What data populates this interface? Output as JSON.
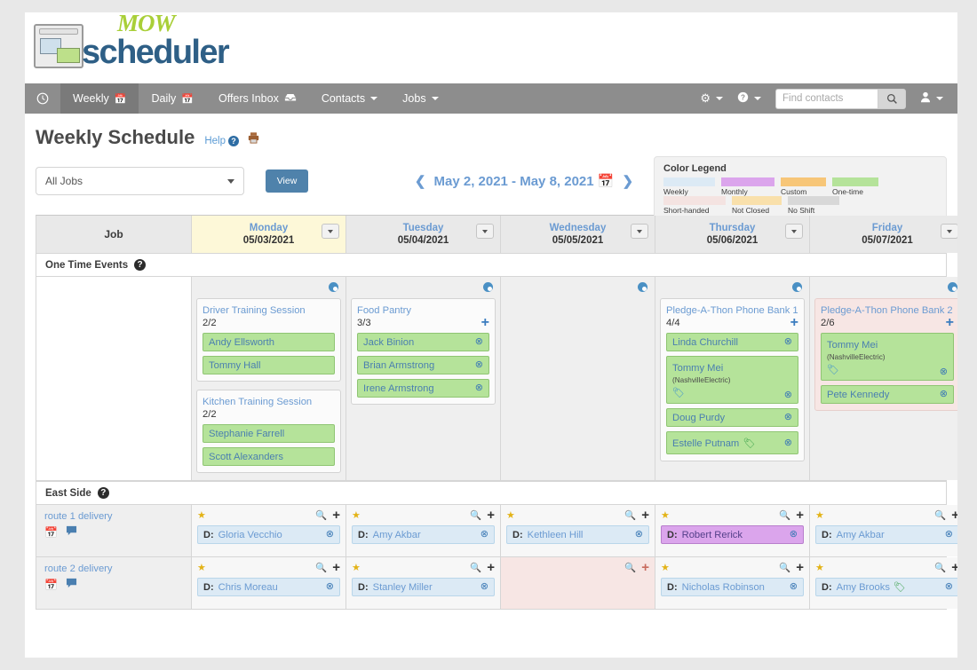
{
  "brand": {
    "mow": "MOW",
    "scheduler": "scheduler"
  },
  "nav": {
    "home_icon": "clock-icon",
    "items": [
      {
        "label": "Weekly",
        "icon": "calendar-icon",
        "active": true
      },
      {
        "label": "Daily",
        "icon": "calendar-icon",
        "active": false
      },
      {
        "label": "Offers Inbox",
        "icon": "inbox-icon",
        "active": false
      },
      {
        "label": "Contacts",
        "icon": "caret-down-icon",
        "active": false
      },
      {
        "label": "Jobs",
        "icon": "caret-down-icon",
        "active": false
      }
    ],
    "right": {
      "gear_icon": "gear-icon",
      "help_icon": "question-circle-icon",
      "user_icon": "user-icon",
      "search_placeholder": "Find contacts",
      "search_value": "",
      "search_button_icon": "search-icon"
    }
  },
  "page": {
    "title": "Weekly Schedule",
    "help_label": "Help",
    "print_icon": "printer-icon"
  },
  "toolbar": {
    "job_filter_value": "All Jobs",
    "view_button": "View",
    "date_range": "May 2, 2021 - May 8, 2021",
    "prev_icon": "chevron-left-icon",
    "next_icon": "chevron-right-icon",
    "calendar_icon": "calendar-icon"
  },
  "legend": {
    "title": "Color Legend",
    "items": [
      {
        "label": "Weekly",
        "color": "#dceaf5"
      },
      {
        "label": "Monthly",
        "color": "#dba5ec"
      },
      {
        "label": "Custom",
        "color": "#f7c678"
      },
      {
        "label": "One-time",
        "color": "#b5e39a"
      },
      {
        "label": "Short-handed",
        "color": "#f4e3e1"
      },
      {
        "label": "Not Closed",
        "color": "#f9e0ab"
      },
      {
        "label": "No Shift",
        "color": "#d8d8d8"
      }
    ]
  },
  "grid": {
    "job_column_header": "Job",
    "days": [
      {
        "name": "Monday",
        "date": "05/03/2021",
        "highlight": true
      },
      {
        "name": "Tuesday",
        "date": "05/04/2021",
        "highlight": false
      },
      {
        "name": "Wednesday",
        "date": "05/05/2021",
        "highlight": false
      },
      {
        "name": "Thursday",
        "date": "05/06/2021",
        "highlight": false
      },
      {
        "name": "Friday",
        "date": "05/07/2021",
        "highlight": false
      }
    ],
    "sections": [
      {
        "title": "One Time Events",
        "help_icon": "question-circle-icon"
      },
      {
        "title": "East Side",
        "help_icon": "question-circle-icon"
      }
    ],
    "one_time_events": [
      {
        "day": "Monday",
        "cards": [
          {
            "title": "Driver Training Session",
            "count": "2/2",
            "short_handed": false,
            "show_plus": false,
            "people": [
              {
                "name": "Andy Ellsworth",
                "sub": "",
                "tag": false,
                "remove": false
              },
              {
                "name": "Tommy Hall",
                "sub": "",
                "tag": false,
                "remove": false
              }
            ]
          },
          {
            "title": "Kitchen Training Session",
            "count": "2/2",
            "short_handed": false,
            "show_plus": false,
            "people": [
              {
                "name": "Stephanie Farrell",
                "sub": "",
                "tag": false,
                "remove": false
              },
              {
                "name": "Scott Alexanders",
                "sub": "",
                "tag": false,
                "remove": false
              }
            ]
          }
        ]
      },
      {
        "day": "Tuesday",
        "cards": [
          {
            "title": "Food Pantry",
            "count": "3/3",
            "short_handed": false,
            "show_plus": true,
            "people": [
              {
                "name": "Jack Binion",
                "sub": "",
                "tag": false,
                "remove": true
              },
              {
                "name": "Brian Armstrong",
                "sub": "",
                "tag": false,
                "remove": true
              },
              {
                "name": "Irene Armstrong",
                "sub": "",
                "tag": false,
                "remove": true
              }
            ]
          }
        ]
      },
      {
        "day": "Wednesday",
        "cards": []
      },
      {
        "day": "Thursday",
        "cards": [
          {
            "title": "Pledge-A-Thon Phone Bank 1",
            "count": "4/4",
            "short_handed": false,
            "show_plus": true,
            "people": [
              {
                "name": "Linda Churchill",
                "sub": "",
                "tag": false,
                "remove": true
              },
              {
                "name": "Tommy Mei",
                "sub": "(NashvilleElectric)",
                "tag": true,
                "remove": true
              },
              {
                "name": "Doug Purdy",
                "sub": "",
                "tag": false,
                "remove": true
              },
              {
                "name": "Estelle Putnam",
                "sub": "",
                "tag": "inline",
                "remove": true
              }
            ]
          }
        ]
      },
      {
        "day": "Friday",
        "cards": [
          {
            "title": "Pledge-A-Thon Phone Bank 2",
            "count": "2/6",
            "short_handed": true,
            "show_plus": true,
            "people": [
              {
                "name": "Tommy Mei",
                "sub": "(NashvilleElectric)",
                "tag": true,
                "remove": true
              },
              {
                "name": "Pete Kennedy",
                "sub": "",
                "tag": false,
                "remove": true
              }
            ]
          }
        ]
      }
    ],
    "job_rows": [
      {
        "name": "route 1 delivery",
        "icons": [
          "calendar-icon",
          "comment-icon"
        ],
        "cells": [
          {
            "day": "Monday",
            "short_handed": false,
            "star": true,
            "plus_red": false,
            "slots": [
              {
                "label": "D:",
                "name": "Gloria Vecchio",
                "type": "weekly",
                "tag": false,
                "remove": true
              }
            ]
          },
          {
            "day": "Tuesday",
            "short_handed": false,
            "star": true,
            "plus_red": false,
            "slots": [
              {
                "label": "D:",
                "name": "Amy Akbar",
                "type": "weekly",
                "tag": false,
                "remove": true
              }
            ]
          },
          {
            "day": "Wednesday",
            "short_handed": false,
            "star": true,
            "plus_red": false,
            "slots": [
              {
                "label": "D:",
                "name": "Kethleen Hill",
                "type": "weekly",
                "tag": false,
                "remove": true
              }
            ]
          },
          {
            "day": "Thursday",
            "short_handed": false,
            "star": true,
            "plus_red": false,
            "slots": [
              {
                "label": "D:",
                "name": "Robert Rerick",
                "type": "monthly",
                "tag": false,
                "remove": true
              }
            ]
          },
          {
            "day": "Friday",
            "short_handed": false,
            "star": true,
            "plus_red": false,
            "slots": [
              {
                "label": "D:",
                "name": "Amy Akbar",
                "type": "weekly",
                "tag": false,
                "remove": true
              }
            ]
          }
        ]
      },
      {
        "name": "route 2 delivery",
        "icons": [
          "calendar-icon",
          "comment-icon"
        ],
        "cells": [
          {
            "day": "Monday",
            "short_handed": false,
            "star": true,
            "plus_red": false,
            "slots": [
              {
                "label": "D:",
                "name": "Chris Moreau",
                "type": "weekly",
                "tag": false,
                "remove": true
              }
            ]
          },
          {
            "day": "Tuesday",
            "short_handed": false,
            "star": true,
            "plus_red": false,
            "slots": [
              {
                "label": "D:",
                "name": "Stanley Miller",
                "type": "weekly",
                "tag": false,
                "remove": true
              }
            ]
          },
          {
            "day": "Wednesday",
            "short_handed": true,
            "star": false,
            "plus_red": true,
            "slots": []
          },
          {
            "day": "Thursday",
            "short_handed": false,
            "star": true,
            "plus_red": false,
            "slots": [
              {
                "label": "D:",
                "name": "Nicholas Robinson",
                "type": "weekly",
                "tag": false,
                "remove": true
              }
            ]
          },
          {
            "day": "Friday",
            "short_handed": false,
            "star": true,
            "plus_red": false,
            "slots": [
              {
                "label": "D:",
                "name": "Amy Brooks",
                "type": "weekly",
                "tag": "inline",
                "remove": true
              }
            ]
          }
        ]
      }
    ]
  }
}
